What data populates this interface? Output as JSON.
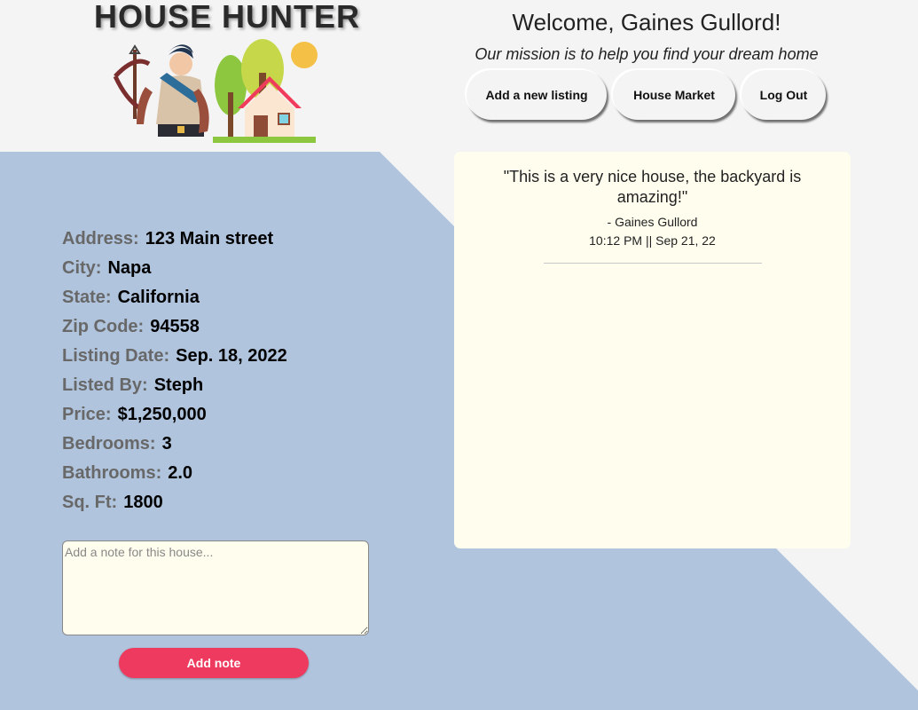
{
  "header": {
    "app_title": "HOUSE HUNTER",
    "welcome": "Welcome, Gaines Gullord!",
    "mission": "Our mission is to help you find your dream home"
  },
  "nav": {
    "add_listing": "Add a new listing",
    "house_market": "House Market",
    "log_out": "Log Out"
  },
  "listing": [
    {
      "label": "Address:",
      "value": "123 Main street"
    },
    {
      "label": "City:",
      "value": "Napa"
    },
    {
      "label": "State:",
      "value": "California"
    },
    {
      "label": "Zip Code:",
      "value": "94558"
    },
    {
      "label": "Listing Date:",
      "value": "Sep. 18, 2022"
    },
    {
      "label": "Listed By:",
      "value": "Steph"
    },
    {
      "label": "Price:",
      "value": "$1,250,000"
    },
    {
      "label": "Bedrooms:",
      "value": "3"
    },
    {
      "label": "Bathrooms:",
      "value": "2.0"
    },
    {
      "label": "Sq. Ft:",
      "value": "1800"
    }
  ],
  "note_form": {
    "placeholder": "Add a note for this house...",
    "submit_label": "Add note"
  },
  "notes": [
    {
      "text": "\"This is a very nice house, the backyard is amazing!\"",
      "author": "- Gaines Gullord",
      "time": "10:12 PM || Sep 21, 22"
    }
  ],
  "colors": {
    "background": "#f4f4f5",
    "diagonal_band": "#b0c4de",
    "panel": "#fffeee",
    "accent_button": "#ee3a5e"
  }
}
